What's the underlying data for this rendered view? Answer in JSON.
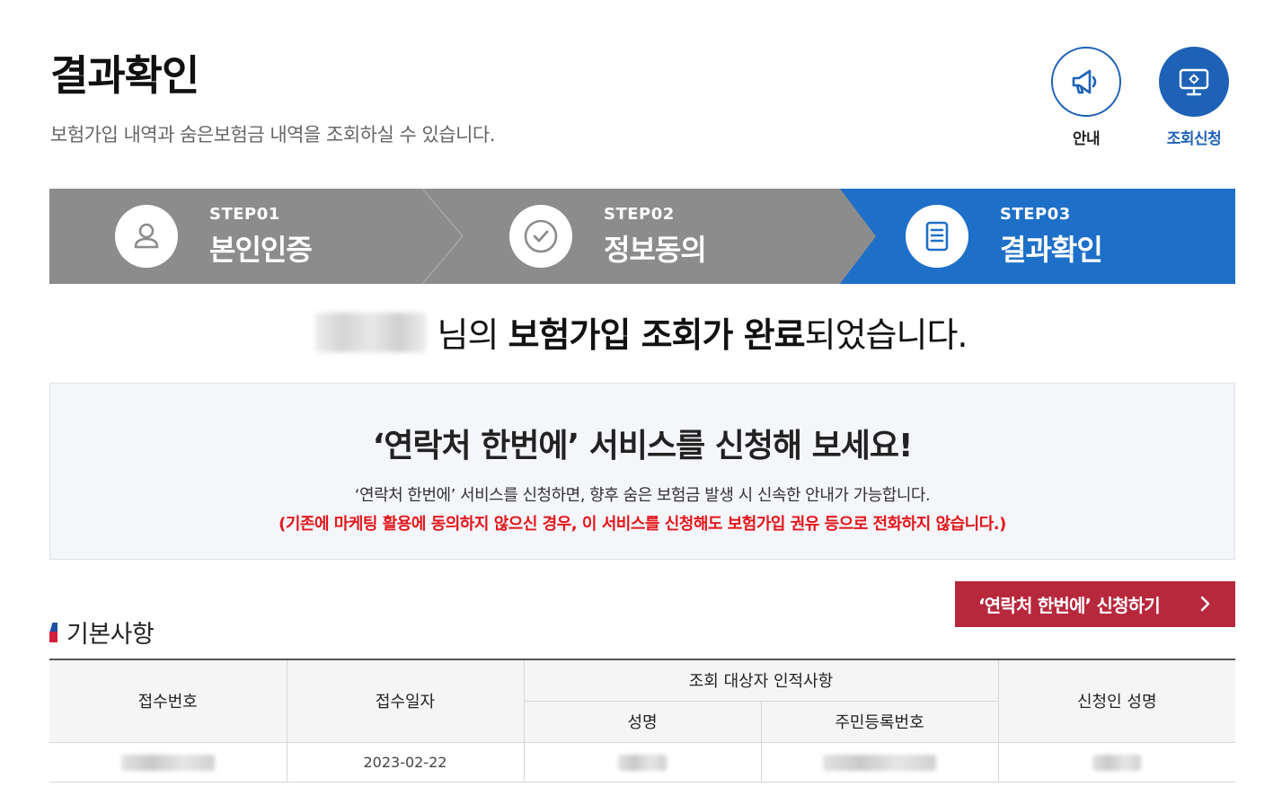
{
  "header": {
    "title": "결과확인",
    "description": "보험가입 내역과 숨은보험금 내역을 조회하실 수 있습니다.",
    "quick_links": [
      {
        "label": "안내",
        "icon": "megaphone-icon"
      },
      {
        "label": "조회신청",
        "icon": "monitor-icon"
      }
    ]
  },
  "steps": [
    {
      "num": "STEP01",
      "name": "본인인증",
      "icon": "person-icon",
      "active": false
    },
    {
      "num": "STEP02",
      "name": "정보동의",
      "icon": "check-circle-icon",
      "active": false
    },
    {
      "num": "STEP03",
      "name": "결과확인",
      "icon": "document-icon",
      "active": true
    }
  ],
  "result": {
    "suffix_1": "님의 ",
    "emphasis": "보험가입 조회가 완료",
    "suffix_2": "되었습니다."
  },
  "promo": {
    "title": "‘연락처 한번에’ 서비스를 신청해 보세요!",
    "description": "‘연락처 한번에’ 서비스를 신청하면, 향후 숨은 보험금 발생 시 신속한 안내가 가능합니다.",
    "warning": "(기존에 마케팅 활용에 동의하지 않으신 경우, 이 서비스를 신청해도 보험가입 권유 등으로 전화하지 않습니다.)"
  },
  "apply_button": {
    "label": "‘연락처 한번에’ 신청하기"
  },
  "basic_info": {
    "section_title": "기본사항",
    "headers": {
      "receipt_no": "접수번호",
      "receipt_date": "접수일자",
      "target_group": "조회 대상자 인적사항",
      "name": "성명",
      "rrn": "주민등록번호",
      "applicant_name": "신청인 성명"
    },
    "row": {
      "receipt_date": "2023-02-22"
    }
  },
  "colors": {
    "primary_blue": "#1e6fc8",
    "step_gray": "#8c8c8c",
    "apply_red": "#b8283d",
    "warning_red": "#e3161a"
  }
}
